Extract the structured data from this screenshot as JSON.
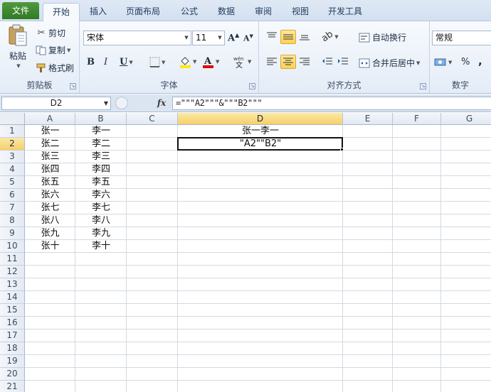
{
  "tabs": [
    "文件",
    "开始",
    "插入",
    "页面布局",
    "公式",
    "数据",
    "审阅",
    "视图",
    "开发工具"
  ],
  "clipboard": {
    "paste": "粘贴",
    "cut": "剪切",
    "copy": "复制",
    "format_painter": "格式刷",
    "label": "剪贴板"
  },
  "font": {
    "name": "宋体",
    "size": "11",
    "bold": "B",
    "italic": "I",
    "underline": "U",
    "label": "字体"
  },
  "alignment": {
    "wrap": "自动换行",
    "merge": "合并后居中",
    "label": "对齐方式"
  },
  "number": {
    "format": "常规",
    "percent": "%",
    "comma": ",",
    "label": "数字"
  },
  "formula_bar": {
    "name_box": "D2",
    "fx": "fx",
    "formula": "=\"\"\"A2\"\"\"&\"\"\"B2\"\"\""
  },
  "columns": [
    "A",
    "B",
    "C",
    "D",
    "E",
    "F",
    "G"
  ],
  "rows": [
    "1",
    "2",
    "3",
    "4",
    "5",
    "6",
    "7",
    "8",
    "9",
    "10",
    "11",
    "12",
    "13",
    "14",
    "15",
    "16",
    "17",
    "18",
    "19",
    "20",
    "21"
  ],
  "cells": {
    "A": [
      "张一",
      "张二",
      "张三",
      "张四",
      "张五",
      "张六",
      "张七",
      "张八",
      "张九",
      "张十"
    ],
    "B": [
      "李一",
      "李二",
      "李三",
      "李四",
      "李五",
      "李六",
      "李七",
      "李八",
      "李九",
      "李十"
    ],
    "D1": "张一李一",
    "D2": "\"A2\"\"B2\""
  },
  "selected_cell": "D2",
  "icons": [
    "paste-icon",
    "scissors-icon",
    "copy-icon",
    "format-painter-icon",
    "fill-color-icon",
    "font-color-icon",
    "wrap-text-icon",
    "merge-center-icon",
    "currency-icon"
  ],
  "colors": {
    "file_tab": "#3a8a2c",
    "selection_header": "#f6cf69"
  }
}
